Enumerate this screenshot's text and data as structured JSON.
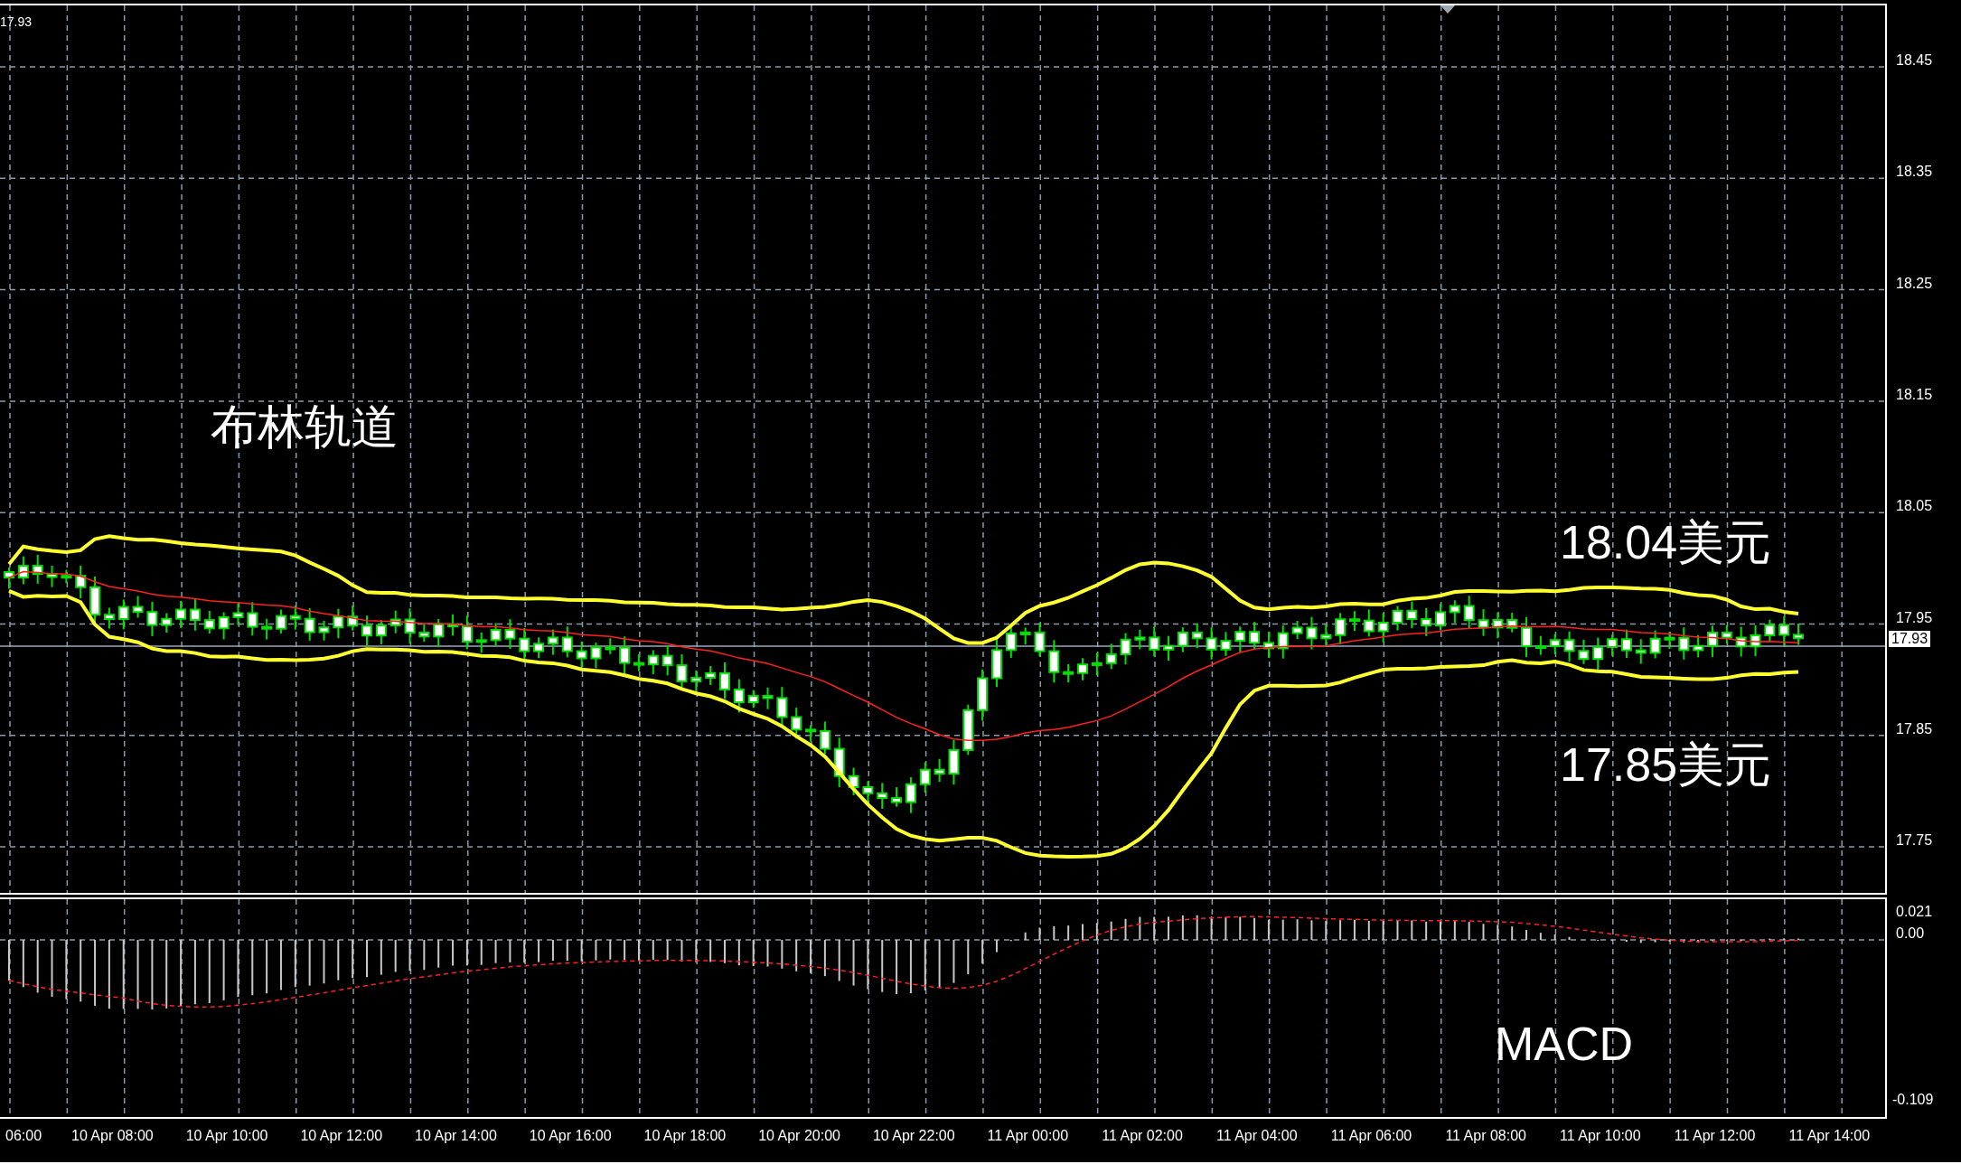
{
  "chart": {
    "top_label": "17.93",
    "annotations": [
      {
        "kind": "title",
        "text": "布林轨道"
      },
      {
        "kind": "upper",
        "text": "18.04美元"
      },
      {
        "kind": "lower",
        "text": "17.85美元"
      }
    ],
    "price_axis": {
      "labels": [
        "18.45",
        "18.35",
        "18.25",
        "18.15",
        "18.05",
        "17.95",
        "17.85",
        "17.75"
      ],
      "current_price": "17.93"
    }
  },
  "macd_panel": {
    "label": "MACD",
    "axis_labels": [
      "0.021",
      "0.00",
      "-0.109"
    ]
  },
  "time_axis": {
    "labels": [
      "06:00",
      "10 Apr 08:00",
      "10 Apr 10:00",
      "10 Apr 12:00",
      "10 Apr 14:00",
      "10 Apr 16:00",
      "10 Apr 18:00",
      "10 Apr 20:00",
      "10 Apr 22:00",
      "11 Apr 00:00",
      "11 Apr 02:00",
      "11 Apr 04:00",
      "11 Apr 06:00",
      "11 Apr 08:00",
      "11 Apr 10:00",
      "11 Apr 12:00",
      "11 Apr 14:00"
    ]
  }
}
